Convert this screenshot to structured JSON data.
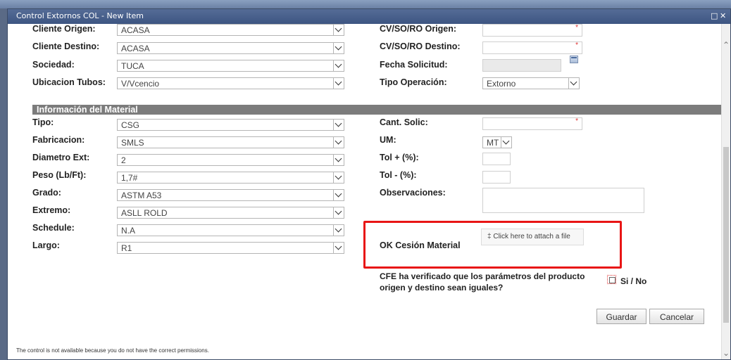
{
  "dialog": {
    "title": "Control Extornos COL - New Item",
    "maximize_icon": "maximize-icon",
    "close_icon": "close-icon"
  },
  "left_fields": [
    {
      "label": "Cliente Origen:",
      "value": "ACASA"
    },
    {
      "label": "Cliente Destino:",
      "value": "ACASA"
    },
    {
      "label": "Sociedad:",
      "value": "TUCA"
    },
    {
      "label": "Ubicacion Tubos:",
      "value": "V/Vcencio"
    }
  ],
  "right_fields": {
    "cvso_origen": {
      "label": "CV/SO/RO Origen:"
    },
    "cvso_destino": {
      "label": "CV/SO/RO Destino:"
    },
    "fecha_solicitud": {
      "label": "Fecha Solicitud:"
    },
    "tipo_operacion": {
      "label": "Tipo Operación:",
      "value": "Extorno"
    }
  },
  "section": {
    "title": "Información del Material"
  },
  "material_fields": [
    {
      "label": "Tipo:",
      "value": "CSG"
    },
    {
      "label": "Fabricacion:",
      "value": "SMLS"
    },
    {
      "label": "Diametro Ext:",
      "value": "2"
    },
    {
      "label": "Peso (Lb/Ft):",
      "value": "1,7#"
    },
    {
      "label": "Grado:",
      "value": "ASTM A53"
    },
    {
      "label": "Extremo:",
      "value": "ASLL ROLD"
    },
    {
      "label": "Schedule:",
      "value": "N.A"
    },
    {
      "label": "Largo:",
      "value": "R1"
    }
  ],
  "material_right": {
    "cant_solic": {
      "label": "Cant. Solic:"
    },
    "um": {
      "label": "UM:",
      "value": "MT"
    },
    "tol_plus": {
      "label": "Tol + (%):"
    },
    "tol_minus": {
      "label": "Tol - (%):"
    },
    "observaciones": {
      "label": "Observaciones:"
    },
    "ok_cesion": {
      "label": "OK Cesión Material",
      "attach": "Click here to attach a file"
    },
    "cfe": {
      "question_line1": "CFE ha verificado que los parámetros del producto",
      "question_line2": "origen y destino sean iguales?",
      "checkbox_label": "Si / No"
    }
  },
  "buttons": {
    "guardar": "Guardar",
    "cancelar": "Cancelar"
  },
  "footer": {
    "message": "The control is not available because you do not have the correct permissions."
  },
  "colors": {
    "titlebar": "#3d5582",
    "section_header": "#7c7c7c",
    "highlight_box": "#e81515",
    "required_marker": "#e03030"
  }
}
